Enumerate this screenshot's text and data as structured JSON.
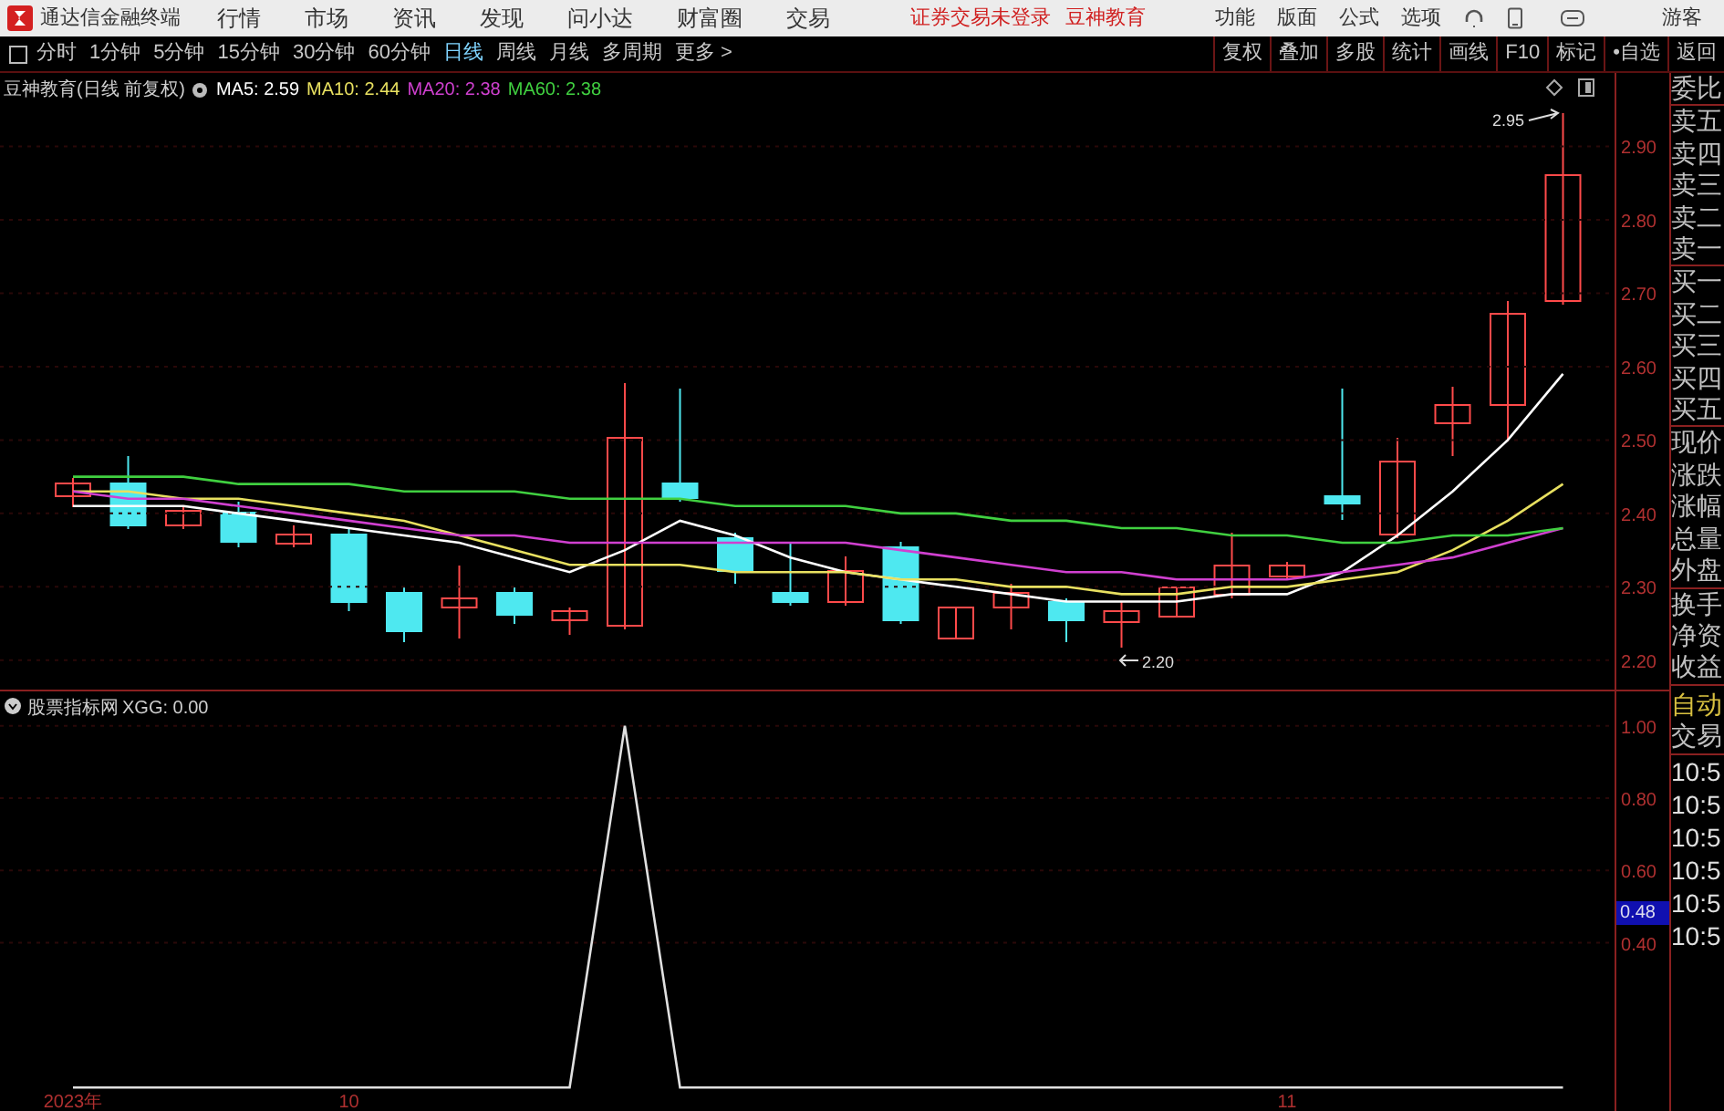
{
  "title_bar": {
    "app_name": "通达信金融终端",
    "menus": [
      "行情",
      "市场",
      "资讯",
      "发现",
      "问小达",
      "财富圈",
      "交易"
    ],
    "notices": [
      "证券交易未登录",
      "豆神教育"
    ],
    "tools": [
      "功能",
      "版面",
      "公式",
      "选项"
    ],
    "user": "游客"
  },
  "period_bar": {
    "periods": [
      {
        "label": "分时",
        "selected": false
      },
      {
        "label": "1分钟",
        "selected": false
      },
      {
        "label": "5分钟",
        "selected": false
      },
      {
        "label": "15分钟",
        "selected": false
      },
      {
        "label": "30分钟",
        "selected": false
      },
      {
        "label": "60分钟",
        "selected": false
      },
      {
        "label": "日线",
        "selected": true
      },
      {
        "label": "周线",
        "selected": false
      },
      {
        "label": "月线",
        "selected": false
      },
      {
        "label": "多周期",
        "selected": false
      }
    ],
    "more": "更多 >",
    "actions": [
      "复权",
      "叠加",
      "多股",
      "统计",
      "画线",
      "F10",
      "标记",
      "•自选",
      "返回"
    ]
  },
  "price_chart": {
    "title": "豆神教育(日线 前复权)",
    "high_marker": "2.95",
    "low_marker": "2.20",
    "chart_data": {
      "type": "line",
      "categories": [
        null,
        null,
        null,
        null,
        null,
        null,
        null,
        null,
        null,
        null,
        null,
        null,
        null,
        null,
        null,
        null,
        null,
        null,
        null,
        null,
        null,
        null,
        null,
        null,
        null,
        null,
        null,
        null
      ],
      "series": [
        {
          "name": "MA5: 2.59",
          "color": "#ffffff",
          "values": [
            2.41,
            2.41,
            2.41,
            2.4,
            2.39,
            2.38,
            2.37,
            2.36,
            2.34,
            2.32,
            2.35,
            2.39,
            2.37,
            2.34,
            2.32,
            2.31,
            2.3,
            2.29,
            2.28,
            2.28,
            2.28,
            2.29,
            2.29,
            2.32,
            2.37,
            2.43,
            2.5,
            2.59
          ]
        },
        {
          "name": "MA10: 2.44",
          "color": "#e8e060",
          "values": [
            2.43,
            2.43,
            2.42,
            2.42,
            2.41,
            2.4,
            2.39,
            2.37,
            2.35,
            2.33,
            2.33,
            2.33,
            2.32,
            2.32,
            2.32,
            2.31,
            2.31,
            2.3,
            2.3,
            2.29,
            2.29,
            2.3,
            2.3,
            2.31,
            2.32,
            2.35,
            2.39,
            2.44
          ]
        },
        {
          "name": "MA20: 2.38",
          "color": "#d040d0",
          "values": [
            2.43,
            2.42,
            2.42,
            2.41,
            2.4,
            2.39,
            2.38,
            2.37,
            2.37,
            2.36,
            2.36,
            2.36,
            2.36,
            2.36,
            2.36,
            2.35,
            2.34,
            2.33,
            2.32,
            2.32,
            2.31,
            2.31,
            2.31,
            2.32,
            2.33,
            2.34,
            2.36,
            2.38
          ]
        },
        {
          "name": "MA60: 2.38",
          "color": "#40d040",
          "values": [
            2.45,
            2.45,
            2.45,
            2.44,
            2.44,
            2.44,
            2.43,
            2.43,
            2.43,
            2.42,
            2.42,
            2.42,
            2.41,
            2.41,
            2.41,
            2.4,
            2.4,
            2.39,
            2.39,
            2.38,
            2.38,
            2.37,
            2.37,
            2.36,
            2.36,
            2.37,
            2.37,
            2.38
          ]
        }
      ],
      "ylim": [
        2.16,
        3.0
      ],
      "grid": true,
      "yticks": [
        {
          "value": 2.9,
          "label": "2.90"
        },
        {
          "value": 2.8,
          "label": "2.80"
        },
        {
          "value": 2.7,
          "label": "2.70"
        },
        {
          "value": 2.6,
          "label": "2.60"
        },
        {
          "value": 2.5,
          "label": "2.50"
        },
        {
          "value": 2.4,
          "label": "2.40"
        },
        {
          "value": 2.3,
          "label": "2.30"
        },
        {
          "value": 2.2,
          "label": "2.20"
        }
      ]
    }
  },
  "indicator_chart": {
    "title": "股票指标网",
    "cursor_value": "0.48",
    "chart_data": {
      "type": "line",
      "categories": [
        "2023年",
        null,
        null,
        null,
        null,
        "10",
        null,
        null,
        null,
        null,
        null,
        null,
        null,
        null,
        null,
        null,
        null,
        null,
        null,
        null,
        null,
        null,
        "11",
        null,
        null,
        null,
        null,
        null
      ],
      "series": [
        {
          "name": "XGG: 0.00",
          "color": "#e0e0e0",
          "values": [
            0,
            0,
            0,
            0,
            0,
            0,
            0,
            0,
            0,
            0,
            1,
            0,
            0,
            0,
            0,
            0,
            0,
            0,
            0,
            0,
            0,
            0,
            0,
            0,
            0,
            0,
            0,
            0
          ]
        }
      ],
      "ylim": [
        -0.065,
        1.1
      ],
      "grid": true,
      "yticks": [
        {
          "value": 0.4,
          "label": "0.40"
        },
        {
          "value": 0.6,
          "label": "0.60"
        },
        {
          "value": 0.8,
          "label": "0.80"
        },
        {
          "value": 1,
          "label": "1.00"
        }
      ]
    }
  },
  "side_panel": {
    "quote_groups": [
      [
        "委比"
      ],
      [
        "卖五",
        "卖四",
        "卖三",
        "卖二",
        "卖一"
      ],
      [
        "买一",
        "买二",
        "买三",
        "买四",
        "买五"
      ],
      [
        "现价",
        "涨跌",
        "涨幅",
        "总量",
        "外盘"
      ],
      [
        "换手",
        "净资",
        "收益"
      ]
    ],
    "trade_mode": "自动",
    "trade_label": "交易",
    "times": [
      "10:5",
      "10:5",
      "10:5",
      "10:5",
      "10:5",
      "10:5"
    ]
  }
}
